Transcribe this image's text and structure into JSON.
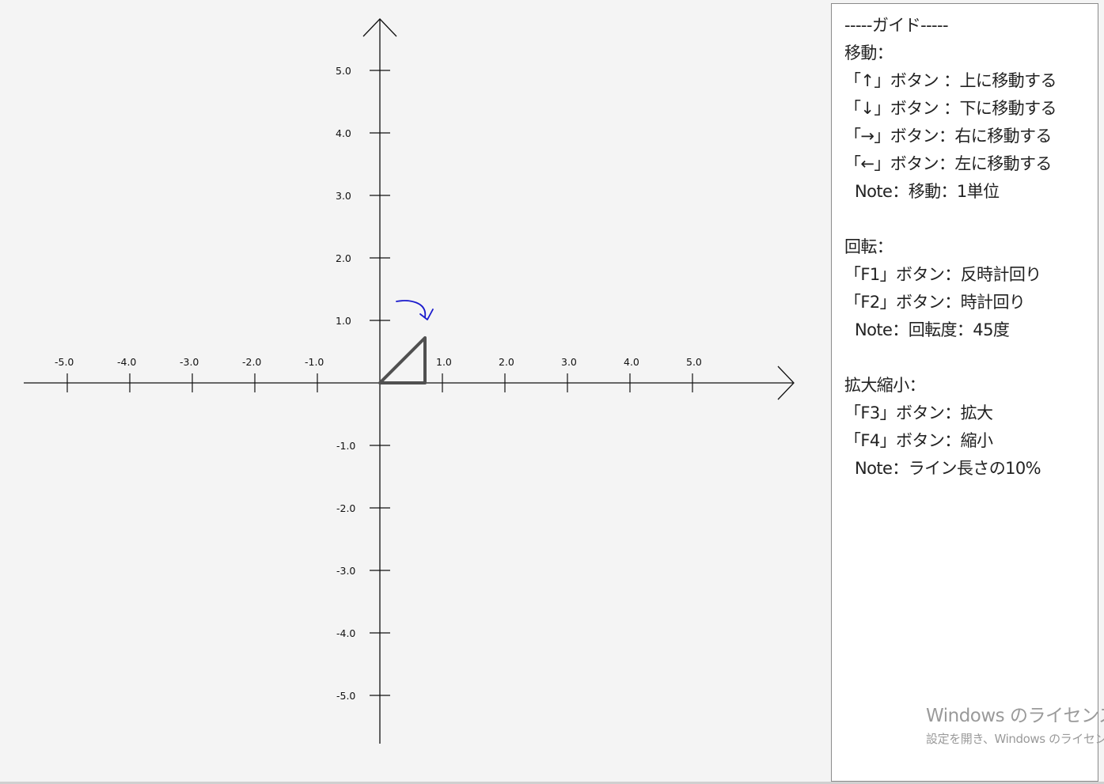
{
  "plane": {
    "x_ticks": [
      "-5.0",
      "-4.0",
      "-3.0",
      "-2.0",
      "-1.0",
      "1.0",
      "2.0",
      "3.0",
      "4.0",
      "5.0"
    ],
    "y_ticks": [
      "5.0",
      "4.0",
      "3.0",
      "2.0",
      "1.0",
      "-1.0",
      "-2.0",
      "-3.0",
      "-4.0",
      "-5.0"
    ],
    "axis_color": "#111111",
    "shape_color": "#505050",
    "rotation_arrow_color": "#1a1acc"
  },
  "guide": {
    "title": "-----ガイド-----",
    "move_header": "移動：",
    "move_up": "「↑」ボタン ：上に移動する",
    "move_down": "「↓」ボタン ：下に移動する",
    "move_right": "「→」ボタン：右に移動する",
    "move_left": "「←」ボタン：左に移動する",
    "move_note": "Note：移動：1単位",
    "rotate_header": "回転：",
    "rotate_ccw": "「F1」ボタン：反時計回り",
    "rotate_cw": "「F2」ボタン：時計回り",
    "rotate_note": "Note：回転度：45度",
    "scale_header": "拡大縮小：",
    "scale_up": "「F3」ボタン：拡大",
    "scale_down": "「F4」ボタン：縮小",
    "scale_note": "Note：ライン長さの10%"
  },
  "watermark": {
    "title": "Windows のライセンス",
    "subtitle": "設定を開き、Windows のライセンス認証を行ってください。"
  }
}
